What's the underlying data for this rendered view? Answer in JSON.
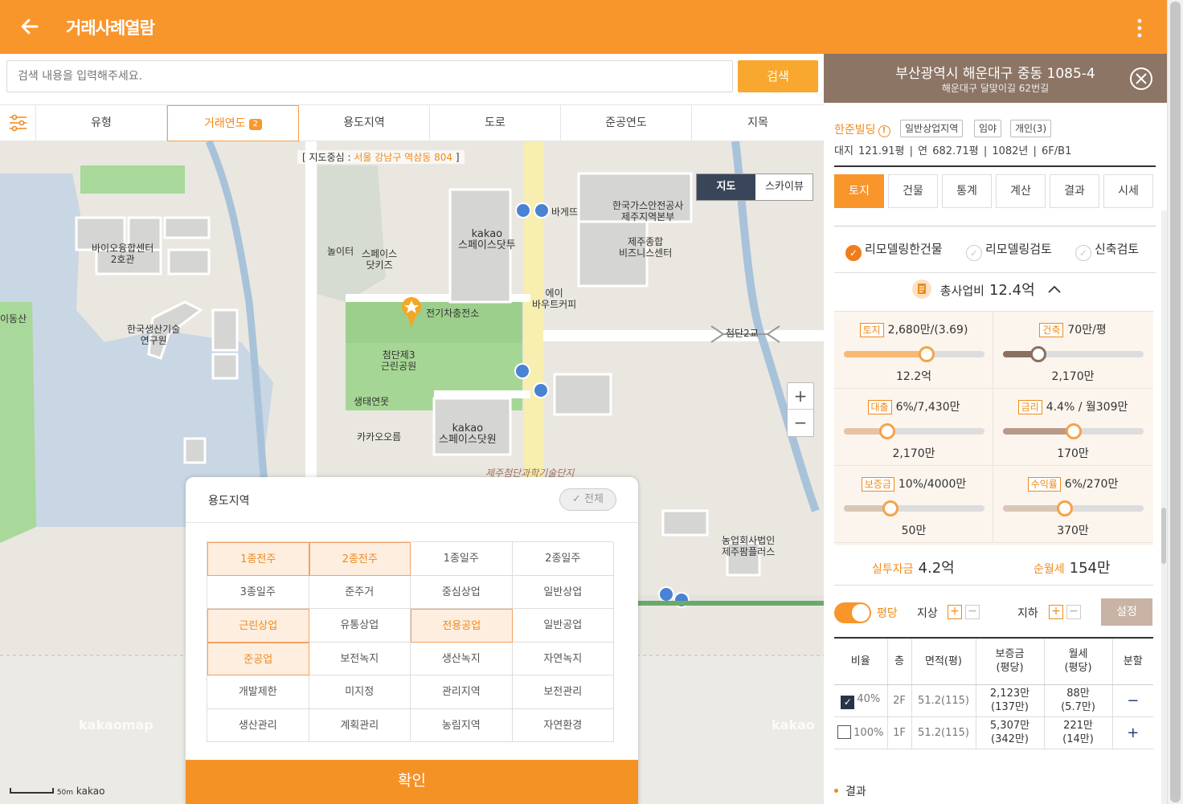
{
  "header": {
    "title": "거래사례열람"
  },
  "search": {
    "placeholder": "검색 내용을 입력해주세요.",
    "button": "검색"
  },
  "filters": {
    "tabs": [
      "유형",
      "거래연도",
      "용도지역",
      "도로",
      "준공연도",
      "지목"
    ],
    "active_count": "2"
  },
  "map": {
    "center_prefix": "[ 지도중심 : ",
    "center_addr": "서울 강남구 역삼동 804",
    "center_suffix": " ]",
    "type_map": "지도",
    "type_sky": "스카이뷰",
    "zoom_in": "+",
    "zoom_out": "−",
    "labels": {
      "bio": "바이오융합센터\n2호관",
      "kaist": "한국생산기술\n연구원",
      "idong": "이동산",
      "play": "놀이터",
      "space": "스페이스\n닷키즈",
      "kakao1": "kakao\n스페이스닷투",
      "charge": "전기차충전소",
      "park": "첨단제3\n근린공원",
      "eco": "생태연못",
      "oreum": "카카오오름",
      "kakao2": "kakao\n스페이스닷원",
      "bagette": "바게뜨",
      "gas": "한국가스안전공사\n제주지역본부",
      "biz": "제주종합\n비즈니스센터",
      "coffee": "에이\n바우트커피",
      "bridge": "첨단2교",
      "techpark": "제주첨단과학기술단지",
      "farm": "농업회사법인\n제주팜플러스"
    },
    "watermark": "kakaomap",
    "watermark2": "kakao",
    "scale": "50m",
    "scale_brand": "kakao"
  },
  "modal": {
    "title": "용도지역",
    "all_button": "✓ 전체",
    "zones": [
      {
        "label": "1종전주",
        "selected": true
      },
      {
        "label": "2종전주",
        "selected": true
      },
      {
        "label": "1종일주",
        "selected": false
      },
      {
        "label": "2종일주",
        "selected": false
      },
      {
        "label": "3종일주",
        "selected": false
      },
      {
        "label": "준주거",
        "selected": false
      },
      {
        "label": "중심상업",
        "selected": false
      },
      {
        "label": "일반상업",
        "selected": false
      },
      {
        "label": "근린상업",
        "selected": true
      },
      {
        "label": "유통상업",
        "selected": false
      },
      {
        "label": "전용공업",
        "selected": true
      },
      {
        "label": "일반공업",
        "selected": false
      },
      {
        "label": "준공업",
        "selected": true
      },
      {
        "label": "보전녹지",
        "selected": false
      },
      {
        "label": "생산녹지",
        "selected": false
      },
      {
        "label": "자연녹지",
        "selected": false
      },
      {
        "label": "개발제한",
        "selected": false
      },
      {
        "label": "미지정",
        "selected": false
      },
      {
        "label": "관리지역",
        "selected": false
      },
      {
        "label": "보전관리",
        "selected": false
      },
      {
        "label": "생산관리",
        "selected": false
      },
      {
        "label": "계획관리",
        "selected": false
      },
      {
        "label": "농림지역",
        "selected": false
      },
      {
        "label": "자연환경",
        "selected": false
      }
    ],
    "confirm": "확인"
  },
  "panel": {
    "address": "부산광역시 해운대구 중동 1085-4",
    "road_address": "해운대구 달맞이길 62번길",
    "building_name": "한준빌딩",
    "tags": [
      "일반상업지역",
      "임야",
      "개인(3)"
    ],
    "info": "대지 121.91평 | 연 682.71평 | 1082년 | 6F/B1",
    "tabs": [
      "토지",
      "건물",
      "통계",
      "계산",
      "결과",
      "시세"
    ],
    "checks": [
      "리모델링한건물",
      "리모델링검토",
      "신축검토"
    ],
    "total_label": "총사업비",
    "total_value": "12.4억",
    "sliders": [
      {
        "badge": "토지",
        "text": "2,680만/(3.69)",
        "value": "12.2억",
        "level": 0.59,
        "color": "#f6b976"
      },
      {
        "badge": "건축",
        "text": "70만/평",
        "value": "2,170만",
        "level": 0.25,
        "color": "#8b6f60"
      },
      {
        "badge": "대출",
        "text": "6%/7,430만",
        "value": "2,170만",
        "level": 0.31,
        "color": "#e6c3a4"
      },
      {
        "badge": "금리",
        "text": "4.4% / 월309만",
        "value": "170만",
        "level": 0.5,
        "color": "#b99a89"
      },
      {
        "badge": "보증금",
        "text": "10%/4000만",
        "value": "50만",
        "level": 0.33,
        "color": "#d9c6b8"
      },
      {
        "badge": "수익률",
        "text": "6%/270만",
        "value": "370만",
        "level": 0.44,
        "color": "#d9c6b8"
      }
    ],
    "actual_label": "실투자금",
    "actual_value": "4.2억",
    "net_label": "순월세",
    "net_value": "154만",
    "toggle_label": "평당",
    "above_label": "지상",
    "below_label": "지하",
    "set_button": "설정",
    "table": {
      "headers": [
        "비율",
        "층",
        "면적(평)",
        "보증금\n(평당)",
        "월세\n(평당)",
        "분할"
      ],
      "rows": [
        {
          "checked": true,
          "ratio": "40%",
          "floor": "2F",
          "area": "51.2(115)",
          "deposit": "2,123만\n(137만)",
          "rent": "88만\n(5.7만)",
          "action": "−"
        },
        {
          "checked": false,
          "ratio": "100%",
          "floor": "1F",
          "area": "51.2(115)",
          "deposit": "5,307만\n(342만)",
          "rent": "221만\n(14만)",
          "action": "+"
        }
      ]
    },
    "result_label": "결과"
  }
}
